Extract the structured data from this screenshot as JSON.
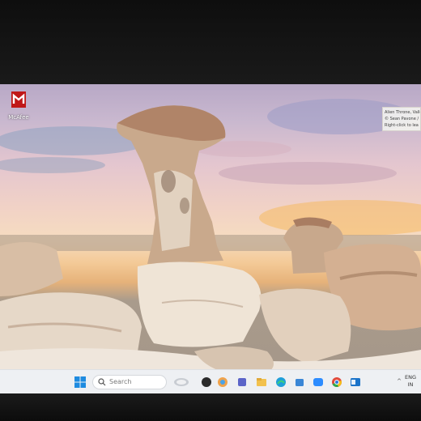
{
  "desktop": {
    "icons": [
      {
        "label": "McAfee",
        "icon": "mcafee-icon",
        "color": "#c01818"
      }
    ],
    "spotlight": {
      "lines": [
        "Alien Throne, Valle",
        "© Sean Pavone /",
        "Right-click to lea"
      ]
    }
  },
  "taskbar": {
    "search_placeholder": "Search",
    "pinned": [
      "widgets-icon",
      "copilot-icon",
      "task-view-icon",
      "file-explorer-icon",
      "edge-icon",
      "store-icon",
      "zoom-icon",
      "chrome-icon",
      "outlook-icon"
    ],
    "tray": {
      "language_line1": "ENG",
      "language_line2": "IN"
    }
  },
  "colors": {
    "taskbar_bg": "#eef0f3",
    "sky_pink": "#e4c6cf",
    "sunset": "#f3c996",
    "rock": "#c7a487"
  }
}
